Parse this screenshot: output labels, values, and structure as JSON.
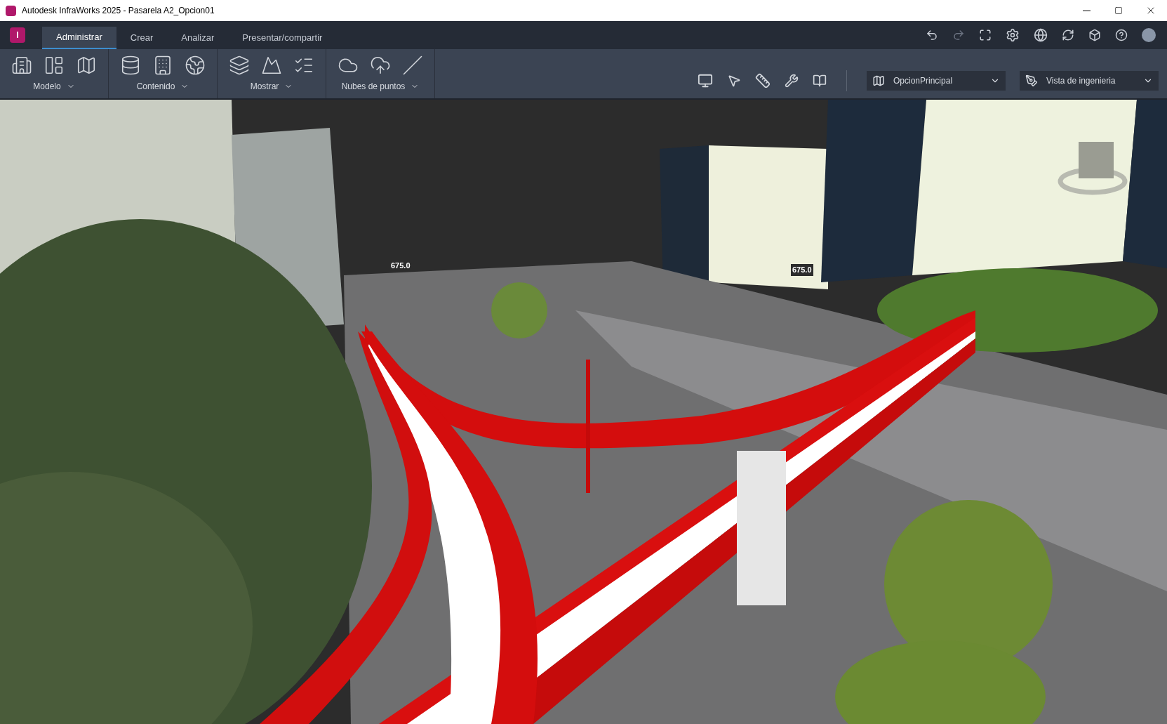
{
  "window": {
    "title": "Autodesk InfraWorks 2025 - Pasarela A2_Opcion01"
  },
  "app_logo": "I",
  "tabs": [
    {
      "label": "Administrar",
      "selected": true
    },
    {
      "label": "Crear",
      "selected": false
    },
    {
      "label": "Analizar",
      "selected": false
    },
    {
      "label": "Presentar/compartir",
      "selected": false
    }
  ],
  "ribbon_groups": [
    {
      "label": "Modelo"
    },
    {
      "label": "Contenido"
    },
    {
      "label": "Mostrar"
    },
    {
      "label": "Nubes de puntos"
    }
  ],
  "proposal_dropdown": {
    "value": "OpcionPrincipal"
  },
  "view_dropdown": {
    "value": "Vista de ingenieria"
  },
  "viewport": {
    "elevation_labels": [
      "675.0",
      "675.0"
    ]
  }
}
